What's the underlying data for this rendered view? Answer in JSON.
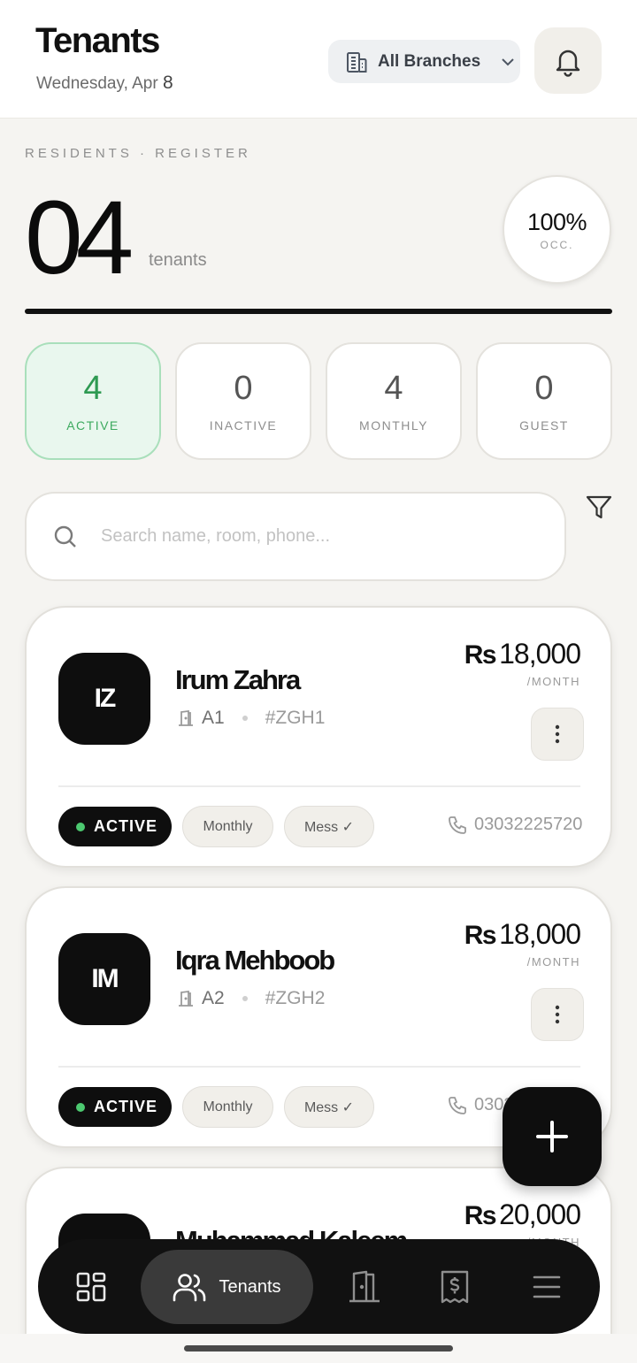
{
  "header": {
    "title": "Tenants",
    "date_prefix": "Wednesday, Apr ",
    "date_day": "8",
    "branch_label": "All Branches"
  },
  "summary": {
    "overline": "RESIDENTS · REGISTER",
    "count": "04",
    "unit": "tenants",
    "occupancy": "100%",
    "occupancy_label": "OCC."
  },
  "stats": [
    {
      "value": "4",
      "label": "ACTIVE"
    },
    {
      "value": "0",
      "label": "INACTIVE"
    },
    {
      "value": "4",
      "label": "MONTHLY"
    },
    {
      "value": "0",
      "label": "GUEST"
    }
  ],
  "search": {
    "placeholder": "Search name, room, phone..."
  },
  "tenants": [
    {
      "initials": "IZ",
      "name": "Irum Zahra",
      "room": "A1",
      "code": "#ZGH1",
      "currency": "Rs",
      "rent": "18,000",
      "period": "/MONTH",
      "status": "ACTIVE",
      "plan": "Monthly",
      "mess": "Mess ✓",
      "phone": "03032225720"
    },
    {
      "initials": "IM",
      "name": "Iqra Mehboob",
      "room": "A2",
      "code": "#ZGH2",
      "currency": "Rs",
      "rent": "18,000",
      "period": "/MONTH",
      "status": "ACTIVE",
      "plan": "Monthly",
      "mess": "Mess ✓",
      "phone": "0303"
    },
    {
      "initials": "",
      "name": "Muhammad Kaleem",
      "room": "",
      "code": "",
      "currency": "Rs",
      "rent": "20,000",
      "period": "/MONTH",
      "status": "",
      "plan": "",
      "mess": "",
      "phone": ""
    }
  ],
  "nav": {
    "active_label": "Tenants",
    "icons": [
      "dashboard-icon",
      "tenants-icon",
      "rooms-door-icon",
      "billing-receipt-icon",
      "menu-icon"
    ]
  },
  "colors": {
    "accent_green": "#4cc970",
    "dark": "#0e0e0e",
    "background": "#f5f4f1"
  }
}
